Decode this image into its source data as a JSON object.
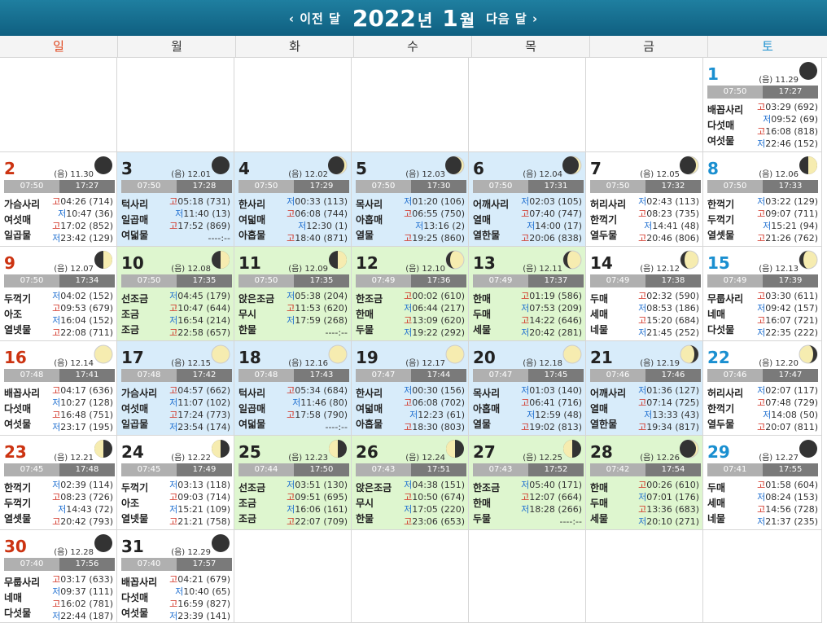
{
  "header": {
    "prev": "‹ 이전 달",
    "next": "다음 달 ›",
    "year": "2022",
    "year_unit": "년",
    "month": "1",
    "month_unit": "월"
  },
  "weekdays": [
    "일",
    "월",
    "화",
    "수",
    "목",
    "금",
    "토"
  ],
  "days": [
    {
      "day": "1",
      "lunar": "(음) 11.29",
      "rise": "07:50",
      "set": "17:27",
      "names": [
        "배꼽사리",
        "다섯매",
        "여섯물"
      ],
      "tides": [
        [
          "고",
          "03:29 (692)"
        ],
        [
          "저",
          "09:52 (69)"
        ],
        [
          "고",
          "16:08 (818)"
        ],
        [
          "저",
          "22:46 (152)"
        ]
      ]
    },
    {
      "day": "2",
      "lunar": "(음) 11.30",
      "rise": "07:50",
      "set": "17:27",
      "names": [
        "가슴사리",
        "여섯매",
        "일곱물"
      ],
      "tides": [
        [
          "고",
          "04:26 (714)"
        ],
        [
          "저",
          "10:47 (36)"
        ],
        [
          "고",
          "17:02 (852)"
        ],
        [
          "저",
          "23:42 (129)"
        ]
      ]
    },
    {
      "day": "3",
      "lunar": "(음) 12.01",
      "rise": "07:50",
      "set": "17:28",
      "names": [
        "턱사리",
        "일곱매",
        "여덟물"
      ],
      "tides": [
        [
          "고",
          "05:18 (731)"
        ],
        [
          "저",
          "11:40 (13)"
        ],
        [
          "고",
          "17:52 (869)"
        ],
        [
          "",
          "----:--"
        ]
      ]
    },
    {
      "day": "4",
      "lunar": "(음) 12.02",
      "rise": "07:50",
      "set": "17:29",
      "names": [
        "한사리",
        "여덟매",
        "아홉물"
      ],
      "tides": [
        [
          "저",
          "00:33 (113)"
        ],
        [
          "고",
          "06:08 (744)"
        ],
        [
          "저",
          "12:30 (1)"
        ],
        [
          "고",
          "18:40 (871)"
        ]
      ]
    },
    {
      "day": "5",
      "lunar": "(음) 12.03",
      "rise": "07:50",
      "set": "17:30",
      "names": [
        "목사리",
        "아홉매",
        "열물"
      ],
      "tides": [
        [
          "저",
          "01:20 (106)"
        ],
        [
          "고",
          "06:55 (750)"
        ],
        [
          "저",
          "13:16 (2)"
        ],
        [
          "고",
          "19:25 (860)"
        ]
      ]
    },
    {
      "day": "6",
      "lunar": "(음) 12.04",
      "rise": "07:50",
      "set": "17:31",
      "names": [
        "어깨사리",
        "열매",
        "열한물"
      ],
      "tides": [
        [
          "저",
          "02:03 (105)"
        ],
        [
          "고",
          "07:40 (747)"
        ],
        [
          "저",
          "14:00 (17)"
        ],
        [
          "고",
          "20:06 (838)"
        ]
      ]
    },
    {
      "day": "7",
      "lunar": "(음) 12.05",
      "rise": "07:50",
      "set": "17:32",
      "names": [
        "허리사리",
        "한꺽기",
        "열두물"
      ],
      "tides": [
        [
          "저",
          "02:43 (113)"
        ],
        [
          "고",
          "08:23 (735)"
        ],
        [
          "저",
          "14:41 (48)"
        ],
        [
          "고",
          "20:46 (806)"
        ]
      ]
    },
    {
      "day": "8",
      "lunar": "(음) 12.06",
      "rise": "07:50",
      "set": "17:33",
      "names": [
        "한꺽기",
        "두꺽기",
        "열셋물"
      ],
      "tides": [
        [
          "저",
          "03:22 (129)"
        ],
        [
          "고",
          "09:07 (711)"
        ],
        [
          "저",
          "15:21 (94)"
        ],
        [
          "고",
          "21:26 (762)"
        ]
      ]
    },
    {
      "day": "9",
      "lunar": "(음) 12.07",
      "rise": "07:50",
      "set": "17:34",
      "names": [
        "두꺽기",
        "아조",
        "열넷물"
      ],
      "tides": [
        [
          "저",
          "04:02 (152)"
        ],
        [
          "고",
          "09:53 (679)"
        ],
        [
          "저",
          "16:04 (152)"
        ],
        [
          "고",
          "22:08 (711)"
        ]
      ]
    },
    {
      "day": "10",
      "lunar": "(음) 12.08",
      "rise": "07:50",
      "set": "17:35",
      "names": [
        "선조금",
        "조금",
        "조금"
      ],
      "tides": [
        [
          "저",
          "04:45 (179)"
        ],
        [
          "고",
          "10:47 (644)"
        ],
        [
          "저",
          "16:54 (214)"
        ],
        [
          "고",
          "22:58 (657)"
        ]
      ]
    },
    {
      "day": "11",
      "lunar": "(음) 12.09",
      "rise": "07:50",
      "set": "17:35",
      "names": [
        "앉은조금",
        "무시",
        "한물"
      ],
      "tides": [
        [
          "저",
          "05:38 (204)"
        ],
        [
          "고",
          "11:53 (620)"
        ],
        [
          "저",
          "17:59 (268)"
        ],
        [
          "",
          "----:--"
        ]
      ]
    },
    {
      "day": "12",
      "lunar": "(음) 12.10",
      "rise": "07:49",
      "set": "17:36",
      "names": [
        "한조금",
        "한매",
        "두물"
      ],
      "tides": [
        [
          "고",
          "00:02 (610)"
        ],
        [
          "저",
          "06:44 (217)"
        ],
        [
          "고",
          "13:09 (620)"
        ],
        [
          "저",
          "19:22 (292)"
        ]
      ]
    },
    {
      "day": "13",
      "lunar": "(음) 12.11",
      "rise": "07:49",
      "set": "17:37",
      "names": [
        "한매",
        "두매",
        "세물"
      ],
      "tides": [
        [
          "고",
          "01:19 (586)"
        ],
        [
          "저",
          "07:53 (209)"
        ],
        [
          "고",
          "14:22 (646)"
        ],
        [
          "저",
          "20:42 (281)"
        ]
      ]
    },
    {
      "day": "14",
      "lunar": "(음) 12.12",
      "rise": "07:49",
      "set": "17:38",
      "names": [
        "두매",
        "세매",
        "네물"
      ],
      "tides": [
        [
          "고",
          "02:32 (590)"
        ],
        [
          "저",
          "08:53 (186)"
        ],
        [
          "고",
          "15:20 (684)"
        ],
        [
          "저",
          "21:45 (252)"
        ]
      ]
    },
    {
      "day": "15",
      "lunar": "(음) 12.13",
      "rise": "07:49",
      "set": "17:39",
      "names": [
        "무룹사리",
        "네매",
        "다섯물"
      ],
      "tides": [
        [
          "고",
          "03:30 (611)"
        ],
        [
          "저",
          "09:42 (157)"
        ],
        [
          "고",
          "16:07 (721)"
        ],
        [
          "저",
          "22:35 (222)"
        ]
      ]
    },
    {
      "day": "16",
      "lunar": "(음) 12.14",
      "rise": "07:48",
      "set": "17:41",
      "names": [
        "배꼽사리",
        "다섯매",
        "여섯물"
      ],
      "tides": [
        [
          "고",
          "04:17 (636)"
        ],
        [
          "저",
          "10:27 (128)"
        ],
        [
          "고",
          "16:48 (751)"
        ],
        [
          "저",
          "23:17 (195)"
        ]
      ]
    },
    {
      "day": "17",
      "lunar": "(음) 12.15",
      "rise": "07:48",
      "set": "17:42",
      "names": [
        "가슴사리",
        "여섯매",
        "일곱물"
      ],
      "tides": [
        [
          "고",
          "04:57 (662)"
        ],
        [
          "저",
          "11:07 (102)"
        ],
        [
          "고",
          "17:24 (773)"
        ],
        [
          "저",
          "23:54 (174)"
        ]
      ]
    },
    {
      "day": "18",
      "lunar": "(음) 12.16",
      "rise": "07:48",
      "set": "17:43",
      "names": [
        "턱사리",
        "일곱매",
        "여덟물"
      ],
      "tides": [
        [
          "고",
          "05:34 (684)"
        ],
        [
          "저",
          "11:46 (80)"
        ],
        [
          "고",
          "17:58 (790)"
        ],
        [
          "",
          "----:--"
        ]
      ]
    },
    {
      "day": "19",
      "lunar": "(음) 12.17",
      "rise": "07:47",
      "set": "17:44",
      "names": [
        "한사리",
        "여덟매",
        "아홉물"
      ],
      "tides": [
        [
          "저",
          "00:30 (156)"
        ],
        [
          "고",
          "06:08 (702)"
        ],
        [
          "저",
          "12:23 (61)"
        ],
        [
          "고",
          "18:30 (803)"
        ]
      ]
    },
    {
      "day": "20",
      "lunar": "(음) 12.18",
      "rise": "07:47",
      "set": "17:45",
      "names": [
        "목사리",
        "아홉매",
        "열물"
      ],
      "tides": [
        [
          "저",
          "01:03 (140)"
        ],
        [
          "고",
          "06:41 (716)"
        ],
        [
          "저",
          "12:59 (48)"
        ],
        [
          "고",
          "19:02 (813)"
        ]
      ]
    },
    {
      "day": "21",
      "lunar": "(음) 12.19",
      "rise": "07:46",
      "set": "17:46",
      "names": [
        "어깨사리",
        "열매",
        "열한물"
      ],
      "tides": [
        [
          "저",
          "01:36 (127)"
        ],
        [
          "고",
          "07:14 (725)"
        ],
        [
          "저",
          "13:33 (43)"
        ],
        [
          "고",
          "19:34 (817)"
        ]
      ]
    },
    {
      "day": "22",
      "lunar": "(음) 12.20",
      "rise": "07:46",
      "set": "17:47",
      "names": [
        "허리사리",
        "한꺽기",
        "열두물"
      ],
      "tides": [
        [
          "저",
          "02:07 (117)"
        ],
        [
          "고",
          "07:48 (729)"
        ],
        [
          "저",
          "14:08 (50)"
        ],
        [
          "고",
          "20:07 (811)"
        ]
      ]
    },
    {
      "day": "23",
      "lunar": "(음) 12.21",
      "rise": "07:45",
      "set": "17:48",
      "names": [
        "한꺽기",
        "두꺽기",
        "열셋물"
      ],
      "tides": [
        [
          "저",
          "02:39 (114)"
        ],
        [
          "고",
          "08:23 (726)"
        ],
        [
          "저",
          "14:43 (72)"
        ],
        [
          "고",
          "20:42 (793)"
        ]
      ]
    },
    {
      "day": "24",
      "lunar": "(음) 12.22",
      "rise": "07:45",
      "set": "17:49",
      "names": [
        "두꺽기",
        "아조",
        "열넷물"
      ],
      "tides": [
        [
          "저",
          "03:13 (118)"
        ],
        [
          "고",
          "09:03 (714)"
        ],
        [
          "저",
          "15:21 (109)"
        ],
        [
          "고",
          "21:21 (758)"
        ]
      ]
    },
    {
      "day": "25",
      "lunar": "(음) 12.23",
      "rise": "07:44",
      "set": "17:50",
      "names": [
        "선조금",
        "조금",
        "조금"
      ],
      "tides": [
        [
          "저",
          "03:51 (130)"
        ],
        [
          "고",
          "09:51 (695)"
        ],
        [
          "저",
          "16:06 (161)"
        ],
        [
          "고",
          "22:07 (709)"
        ]
      ]
    },
    {
      "day": "26",
      "lunar": "(음) 12.24",
      "rise": "07:43",
      "set": "17:51",
      "names": [
        "앉은조금",
        "무시",
        "한물"
      ],
      "tides": [
        [
          "저",
          "04:38 (151)"
        ],
        [
          "고",
          "10:50 (674)"
        ],
        [
          "저",
          "17:05 (220)"
        ],
        [
          "고",
          "23:06 (653)"
        ]
      ]
    },
    {
      "day": "27",
      "lunar": "(음) 12.25",
      "rise": "07:43",
      "set": "17:52",
      "names": [
        "한조금",
        "한매",
        "두물"
      ],
      "tides": [
        [
          "저",
          "05:40 (171)"
        ],
        [
          "고",
          "12:07 (664)"
        ],
        [
          "저",
          "18:28 (266)"
        ],
        [
          "",
          "----:--"
        ]
      ]
    },
    {
      "day": "28",
      "lunar": "(음) 12.26",
      "rise": "07:42",
      "set": "17:54",
      "names": [
        "한매",
        "두매",
        "세물"
      ],
      "tides": [
        [
          "고",
          "00:26 (610)"
        ],
        [
          "저",
          "07:01 (176)"
        ],
        [
          "고",
          "13:36 (683)"
        ],
        [
          "저",
          "20:10 (271)"
        ]
      ]
    },
    {
      "day": "29",
      "lunar": "(음) 12.27",
      "rise": "07:41",
      "set": "17:55",
      "names": [
        "두매",
        "세매",
        "네물"
      ],
      "tides": [
        [
          "고",
          "01:58 (604)"
        ],
        [
          "저",
          "08:24 (153)"
        ],
        [
          "고",
          "14:56 (728)"
        ],
        [
          "저",
          "21:37 (235)"
        ]
      ]
    },
    {
      "day": "30",
      "lunar": "(음) 12.28",
      "rise": "07:40",
      "set": "17:56",
      "names": [
        "무룹사리",
        "네매",
        "다섯물"
      ],
      "tides": [
        [
          "고",
          "03:17 (633)"
        ],
        [
          "저",
          "09:37 (111)"
        ],
        [
          "고",
          "16:02 (781)"
        ],
        [
          "저",
          "22:44 (187)"
        ]
      ]
    },
    {
      "day": "31",
      "lunar": "(음) 12.29",
      "rise": "07:40",
      "set": "17:57",
      "names": [
        "배꼽사리",
        "다섯매",
        "여섯물"
      ],
      "tides": [
        [
          "고",
          "04:21 (679)"
        ],
        [
          "저",
          "10:40 (65)"
        ],
        [
          "고",
          "16:59 (827)"
        ],
        [
          "저",
          "23:39 (141)"
        ]
      ]
    }
  ]
}
